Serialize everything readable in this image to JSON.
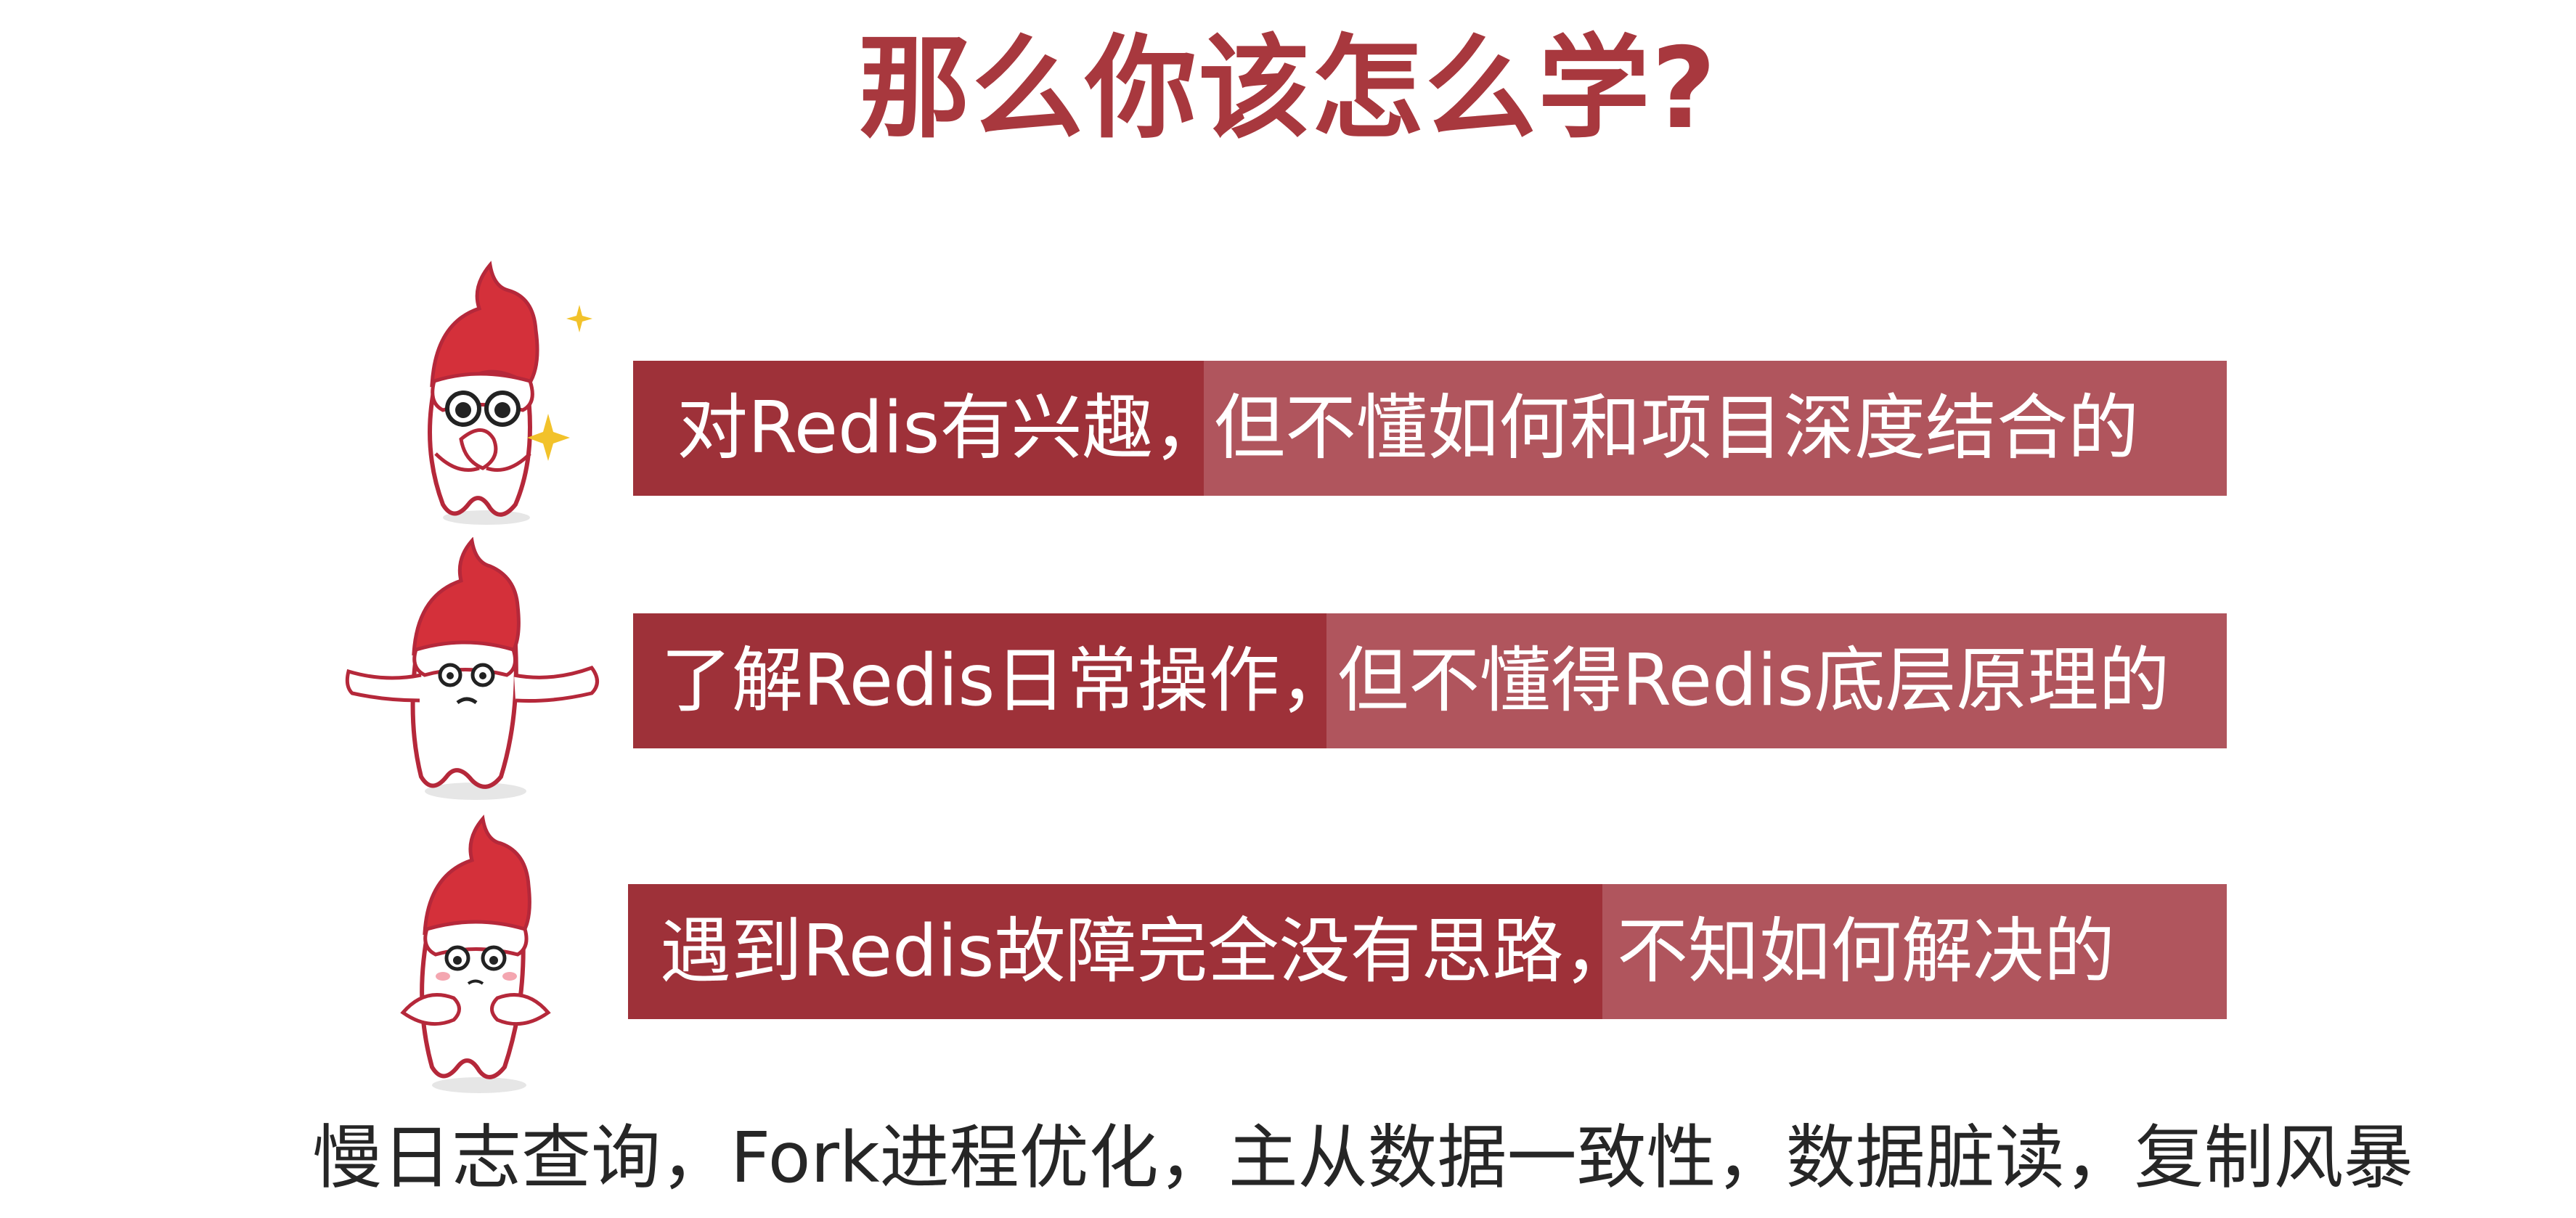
{
  "title": "那么你该怎么学?",
  "rows": [
    {
      "dark_text": "对Redis有兴趣，",
      "light_text": "但不懂如何和项目深度结合的"
    },
    {
      "dark_text": "了解Redis日常操作，",
      "light_text": "但不懂得Redis底层原理的"
    },
    {
      "dark_text": "遇到Redis故障完全没有思路，",
      "light_text": "不知如何解决的"
    }
  ],
  "footer": "慢日志查询，Fork进程优化，主从数据一致性，数据脏读，复制风暴",
  "colors": {
    "title": "#a8383e",
    "bar_dark": "#9e3139",
    "bar_light": "#b0555d",
    "footer_text": "#262626",
    "mascot_hair": "#d4303a",
    "mascot_outline": "#b5283a",
    "sparkle": "#f2c22a"
  },
  "icons": [
    "mascot-excited-icon",
    "mascot-shrug-icon",
    "mascot-worried-icon",
    "sparkle-icon"
  ]
}
